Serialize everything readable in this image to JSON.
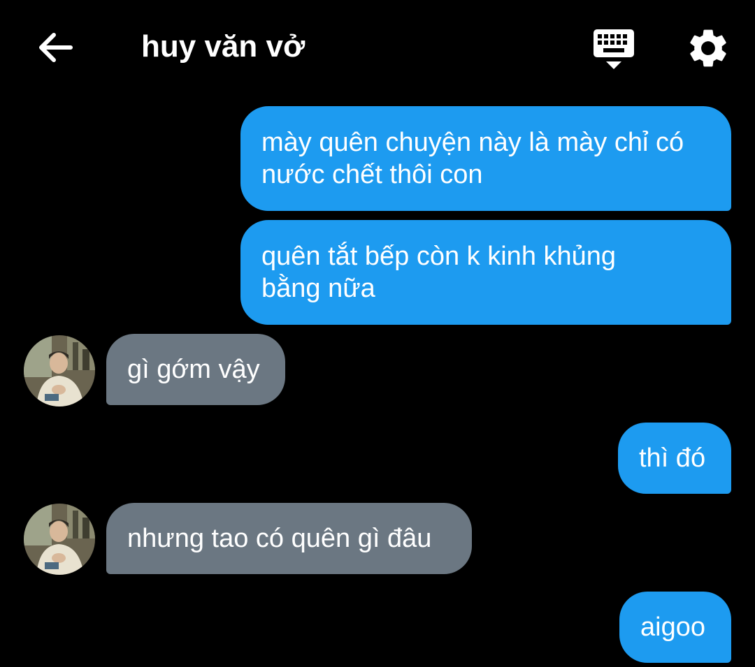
{
  "header": {
    "title": "huy văn vở",
    "back_icon": "arrow-left-icon",
    "keyboard_icon": "keyboard-hide-icon",
    "settings_icon": "gear-icon"
  },
  "colors": {
    "background": "#000000",
    "sent_bubble": "#1d9bf0",
    "received_bubble": "#6b7782"
  },
  "messages": [
    {
      "from": "me",
      "lines": [
        "mày quên chuyện này là mày chỉ có",
        "nước chết thôi con"
      ]
    },
    {
      "from": "me",
      "lines": [
        "quên tắt bếp còn k kinh khủng",
        "bằng nữa"
      ]
    },
    {
      "from": "other",
      "lines": [
        "gì gớm vậy"
      ]
    },
    {
      "from": "me",
      "lines": [
        "thì đó"
      ]
    },
    {
      "from": "other",
      "lines": [
        "nhưng tao có quên gì đâu"
      ]
    },
    {
      "from": "me",
      "lines": [
        "aigoo"
      ]
    }
  ]
}
